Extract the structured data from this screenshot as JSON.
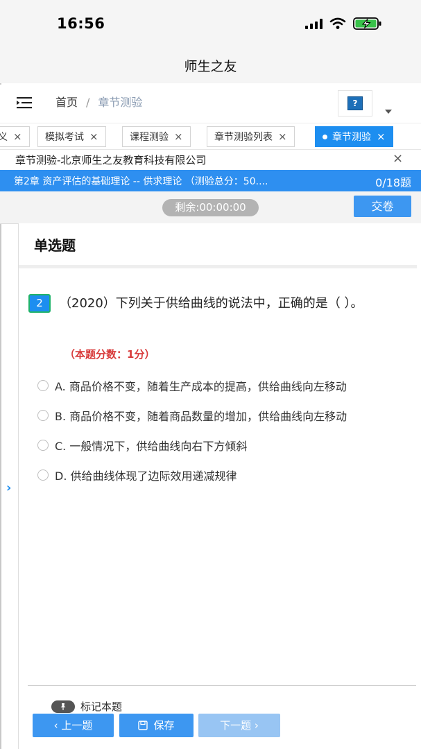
{
  "status_bar": {
    "time": "16:56"
  },
  "app": {
    "title": "师生之友"
  },
  "nav": {
    "breadcrumb_home": "首页",
    "breadcrumb_separator": "/",
    "breadcrumb_current": "章节测验",
    "help_icon_text": "?"
  },
  "tabs": [
    {
      "label": "义",
      "close": "×"
    },
    {
      "label": "模拟考试",
      "close": "×"
    },
    {
      "label": "课程测验",
      "close": "×"
    },
    {
      "label": "章节测验列表",
      "close": "×"
    },
    {
      "label": "章节测验",
      "close": "×",
      "active": true
    }
  ],
  "company": {
    "text": "章节测验-北京师生之友教育科技有限公司",
    "close": "×"
  },
  "chapter": {
    "title": "第2章 资产评估的基础理论 -- 供求理论 （测验总分：50....",
    "progress": "0/18题"
  },
  "timer": {
    "remaining": "剩余:00:00:00",
    "submit_label": "交卷"
  },
  "section": {
    "heading": "单选题"
  },
  "question": {
    "number": "2",
    "text": "（2020）下列关于供给曲线的说法中，正确的是（ ）。",
    "score": "（本题分数：1分）",
    "options": [
      "A. 商品价格不变，随着生产成本的提高，供给曲线向左移动",
      "B. 商品价格不变，随着商品数量的增加，供给曲线向左移动",
      "C. 一般情况下，供给曲线向右下方倾斜",
      "D. 供给曲线体现了边际效用递减规律"
    ]
  },
  "side_arrow": "›",
  "footer": {
    "mark_label": "标记本题",
    "prev_label": "‹ 上一题",
    "save_label": "保存",
    "next_label": "下一题 ›"
  },
  "colors": {
    "accent": "#2e8ff0",
    "score_red": "#d83a3a",
    "disabled_button": "#98c5f3"
  },
  "icons": [
    "signal-icon",
    "wifi-icon",
    "battery-charging-icon",
    "menu-icon",
    "help-icon",
    "chevron-down-icon",
    "close-icon",
    "pin-icon",
    "save-icon"
  ]
}
